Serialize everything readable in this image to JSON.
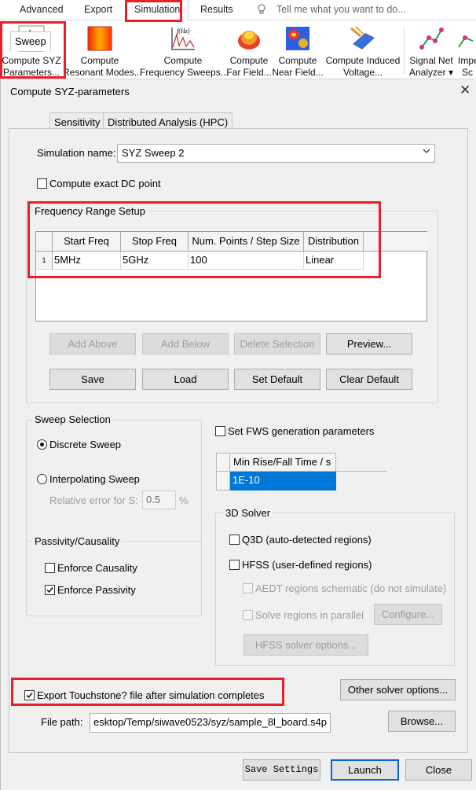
{
  "ribbon": {
    "tabs": [
      "Advanced",
      "Export",
      "Simulation",
      "Results"
    ],
    "active_tab": "Simulation",
    "tell_me": "Tell me what you want to do...",
    "buttons": [
      {
        "line1": "Compute SYZ",
        "line2": "Parameters...",
        "icon": "syz-parameters-icon"
      },
      {
        "line1": "Compute",
        "line2": "Resonant Modes...",
        "icon": "resonant-modes-icon"
      },
      {
        "line1": "Compute",
        "line2": "Frequency Sweeps...",
        "icon": "frequency-sweep-icon",
        "icon_text": "f(Hz)"
      },
      {
        "line1": "Compute",
        "line2": "Far Field...",
        "icon": "far-field-icon"
      },
      {
        "line1": "Compute",
        "line2": "Near Field...",
        "icon": "near-field-icon"
      },
      {
        "line1": "Compute Induced",
        "line2": "Voltage...",
        "icon": "induced-voltage-icon"
      },
      {
        "line1": "Signal Net",
        "line2": "Analyzer ▾",
        "icon": "signal-net-analyzer-icon"
      },
      {
        "line1": "Impe",
        "line2": "Sc",
        "icon": "impedance-icon"
      }
    ]
  },
  "dialog": {
    "title": "Compute SYZ-parameters",
    "tabs": [
      "Sweep",
      "Sensitivity",
      "Distributed Analysis (HPC)"
    ],
    "active_tab": "Sweep",
    "simulation_name_label": "Simulation name:",
    "simulation_name": "SYZ Sweep 2",
    "dc_point_label": "Compute exact DC point",
    "dc_point_checked": false,
    "freq_group_title": "Frequency Range Setup",
    "freq_table": {
      "columns": [
        "Start Freq",
        "Stop Freq",
        "Num. Points / Step Size",
        "Distribution"
      ],
      "rows": [
        {
          "index": "1",
          "start": "5MHz",
          "stop": "5GHz",
          "points": "100",
          "distribution": "Linear"
        }
      ]
    },
    "buttons_row1": [
      "Add Above",
      "Add Below",
      "Delete Selection",
      "Preview..."
    ],
    "buttons_row2": [
      "Save",
      "Load",
      "Set Default",
      "Clear Default"
    ],
    "sweep_selection": {
      "title": "Sweep Selection",
      "discrete": "Discrete Sweep",
      "interpolating": "Interpolating Sweep",
      "selected": "discrete",
      "rel_error_label": "Relative error for S:",
      "rel_error_value": "0.5",
      "rel_error_unit": "%"
    },
    "passivity": {
      "title": "Passivity/Causality",
      "causality_label": "Enforce Causality",
      "causality_checked": false,
      "passivity_label": "Enforce Passivity",
      "passivity_checked": true
    },
    "fws": {
      "label": "Set FWS generation parameters",
      "checked": false,
      "column": "Min Rise/Fall Time / s",
      "value": "1E-10"
    },
    "solver3d": {
      "title": "3D Solver",
      "q3d_label": "Q3D (auto-detected regions)",
      "hfss_label": "HFSS (user-defined regions)",
      "aedt_label": "AEDT regions schematic (do not simulate)",
      "parallel_label": "Solve regions in parallel",
      "configure_label": "Configure...",
      "hfss_options_label": "HFSS solver options..."
    },
    "export_label": "Export Touchstone? file after simulation completes",
    "export_checked": true,
    "other_solver_label": "Other solver options...",
    "file_path_label": "File path:",
    "file_path": "esktop/Temp/siwave0523/syz/sample_8l_board.s4p",
    "browse_label": "Browse...",
    "save_settings_label": "Save Settings",
    "launch_label": "Launch",
    "close_label": "Close"
  },
  "colors": {
    "highlight": "#e8202a",
    "selection": "#0078d7",
    "primary_border": "#0a64d8"
  }
}
